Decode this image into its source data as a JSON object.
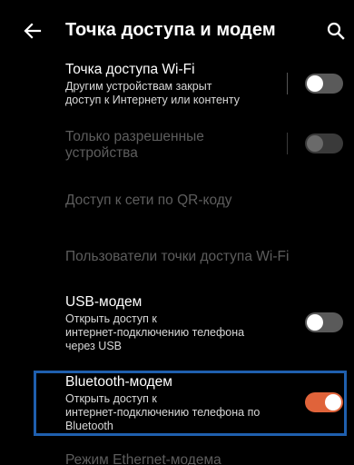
{
  "header": {
    "title": "Точка доступа и модем",
    "back_icon": "arrow-back-icon",
    "search_icon": "search-icon"
  },
  "settings": {
    "wifi_hotspot": {
      "title": "Точка доступа Wi-Fi",
      "subtitle_line1": "Другим устройствам закрыт",
      "subtitle_line2": "доступ к Интернету или контенту",
      "enabled": false
    },
    "allowed_devices": {
      "title_line1": "Только разрешенные",
      "title_line2": "устройства",
      "enabled": false,
      "disabled": true
    },
    "qr_access": {
      "title": "Доступ к сети по QR-коду",
      "disabled": true
    },
    "hotspot_users": {
      "title": "Пользователи точки доступа Wi-Fi",
      "disabled": true
    },
    "usb_tethering": {
      "title": "USB-модем",
      "subtitle_line1": "Открыть доступ к",
      "subtitle_line2": "интернет-подключению телефона",
      "subtitle_line3": "через USB",
      "enabled": false
    },
    "bluetooth_tethering": {
      "title": "Bluetooth-модем",
      "subtitle_line1": "Открыть доступ к",
      "subtitle_line2": "интернет-подключению телефона по",
      "subtitle_line3": "Bluetooth",
      "enabled": true
    },
    "ethernet_tethering": {
      "title": "Режим Ethernet-модема",
      "disabled": true
    }
  },
  "colors": {
    "accent": "#e0633a",
    "highlight_border": "#1f5fae",
    "background": "#000000"
  }
}
